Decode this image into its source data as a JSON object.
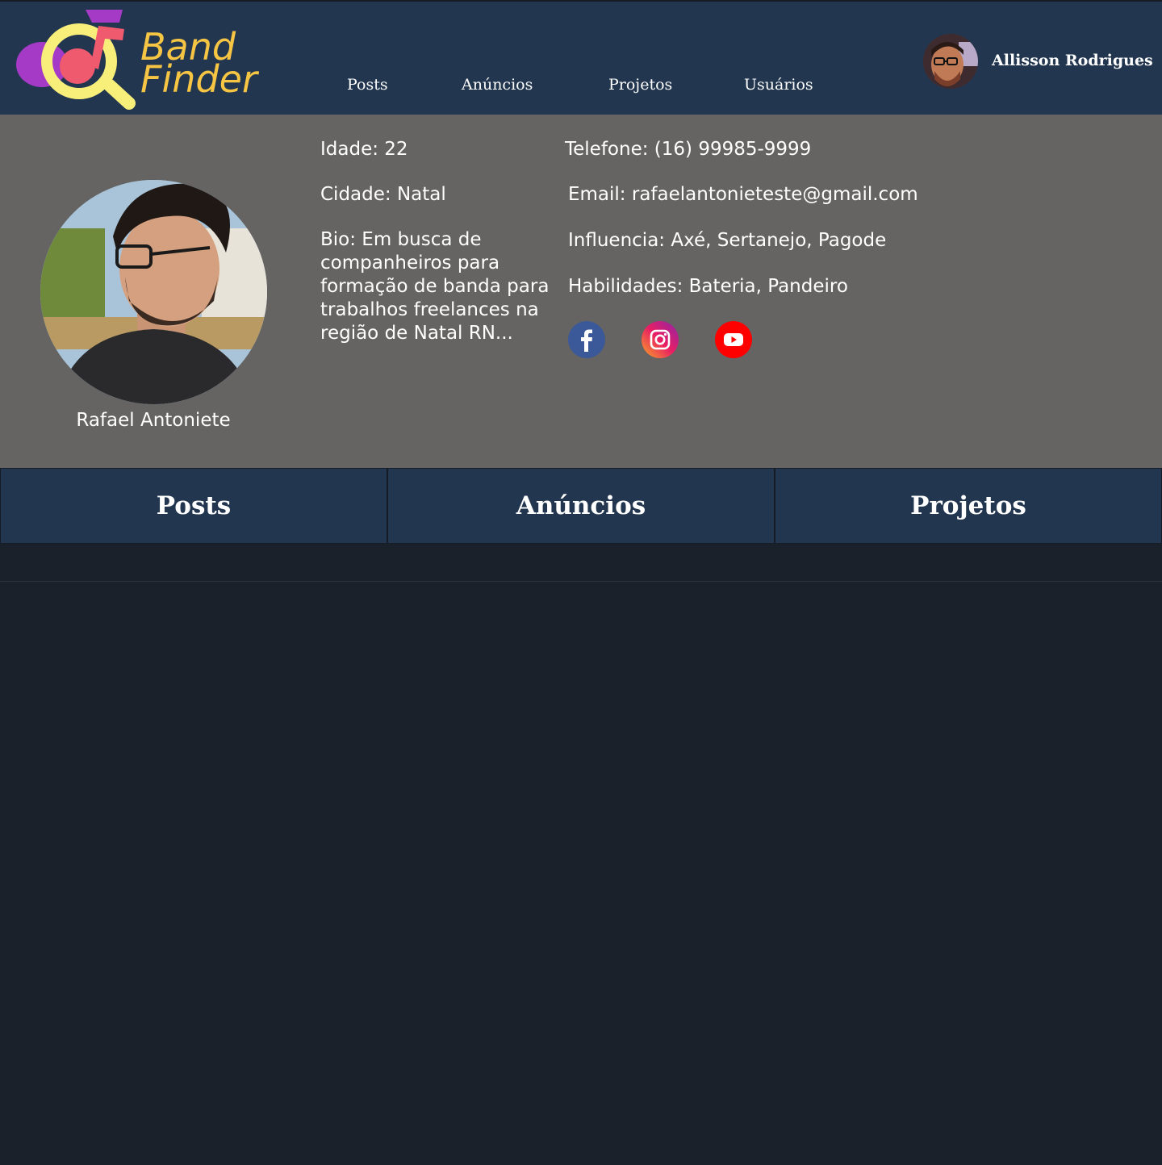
{
  "header": {
    "logo": {
      "line1": "Band",
      "line2": "Finder",
      "colors": {
        "text": "#f6c544",
        "lens": "#f8ef7a",
        "note": "#ef5a6f",
        "accent": "#a53ac6"
      }
    },
    "nav": [
      {
        "label": "Posts"
      },
      {
        "label": "Anúncios"
      },
      {
        "label": "Projetos"
      },
      {
        "label": "Usuários"
      }
    ],
    "user": {
      "name": "Allisson Rodrigues",
      "avatar_icon": "user-avatar-photo"
    }
  },
  "profile": {
    "name": "Rafael Antoniete",
    "photo_icon": "profile-photo",
    "age": "Idade: 22",
    "city": "Cidade: Natal",
    "bio": "Bio: Em busca de companheiros para formação de banda para trabalhos freelances na região de Natal RN...",
    "phone": "Telefone: (16) 99985-9999",
    "email": "Email: rafaelantonieteste@gmail.com",
    "influence": "Influencia: Axé, Sertanejo, Pagode",
    "skills": "Habilidades: Bateria, Pandeiro",
    "social": [
      {
        "icon": "facebook-icon",
        "color": "#3b5998"
      },
      {
        "icon": "instagram-icon",
        "color": "#c13584"
      },
      {
        "icon": "youtube-icon",
        "color": "#ff0000"
      }
    ]
  },
  "tabs": [
    {
      "label": "Posts"
    },
    {
      "label": "Anúncios"
    },
    {
      "label": "Projetos"
    }
  ],
  "theme": {
    "header_bg": "#22364f",
    "profile_bg": "#656462",
    "page_bg": "#1b212b"
  }
}
